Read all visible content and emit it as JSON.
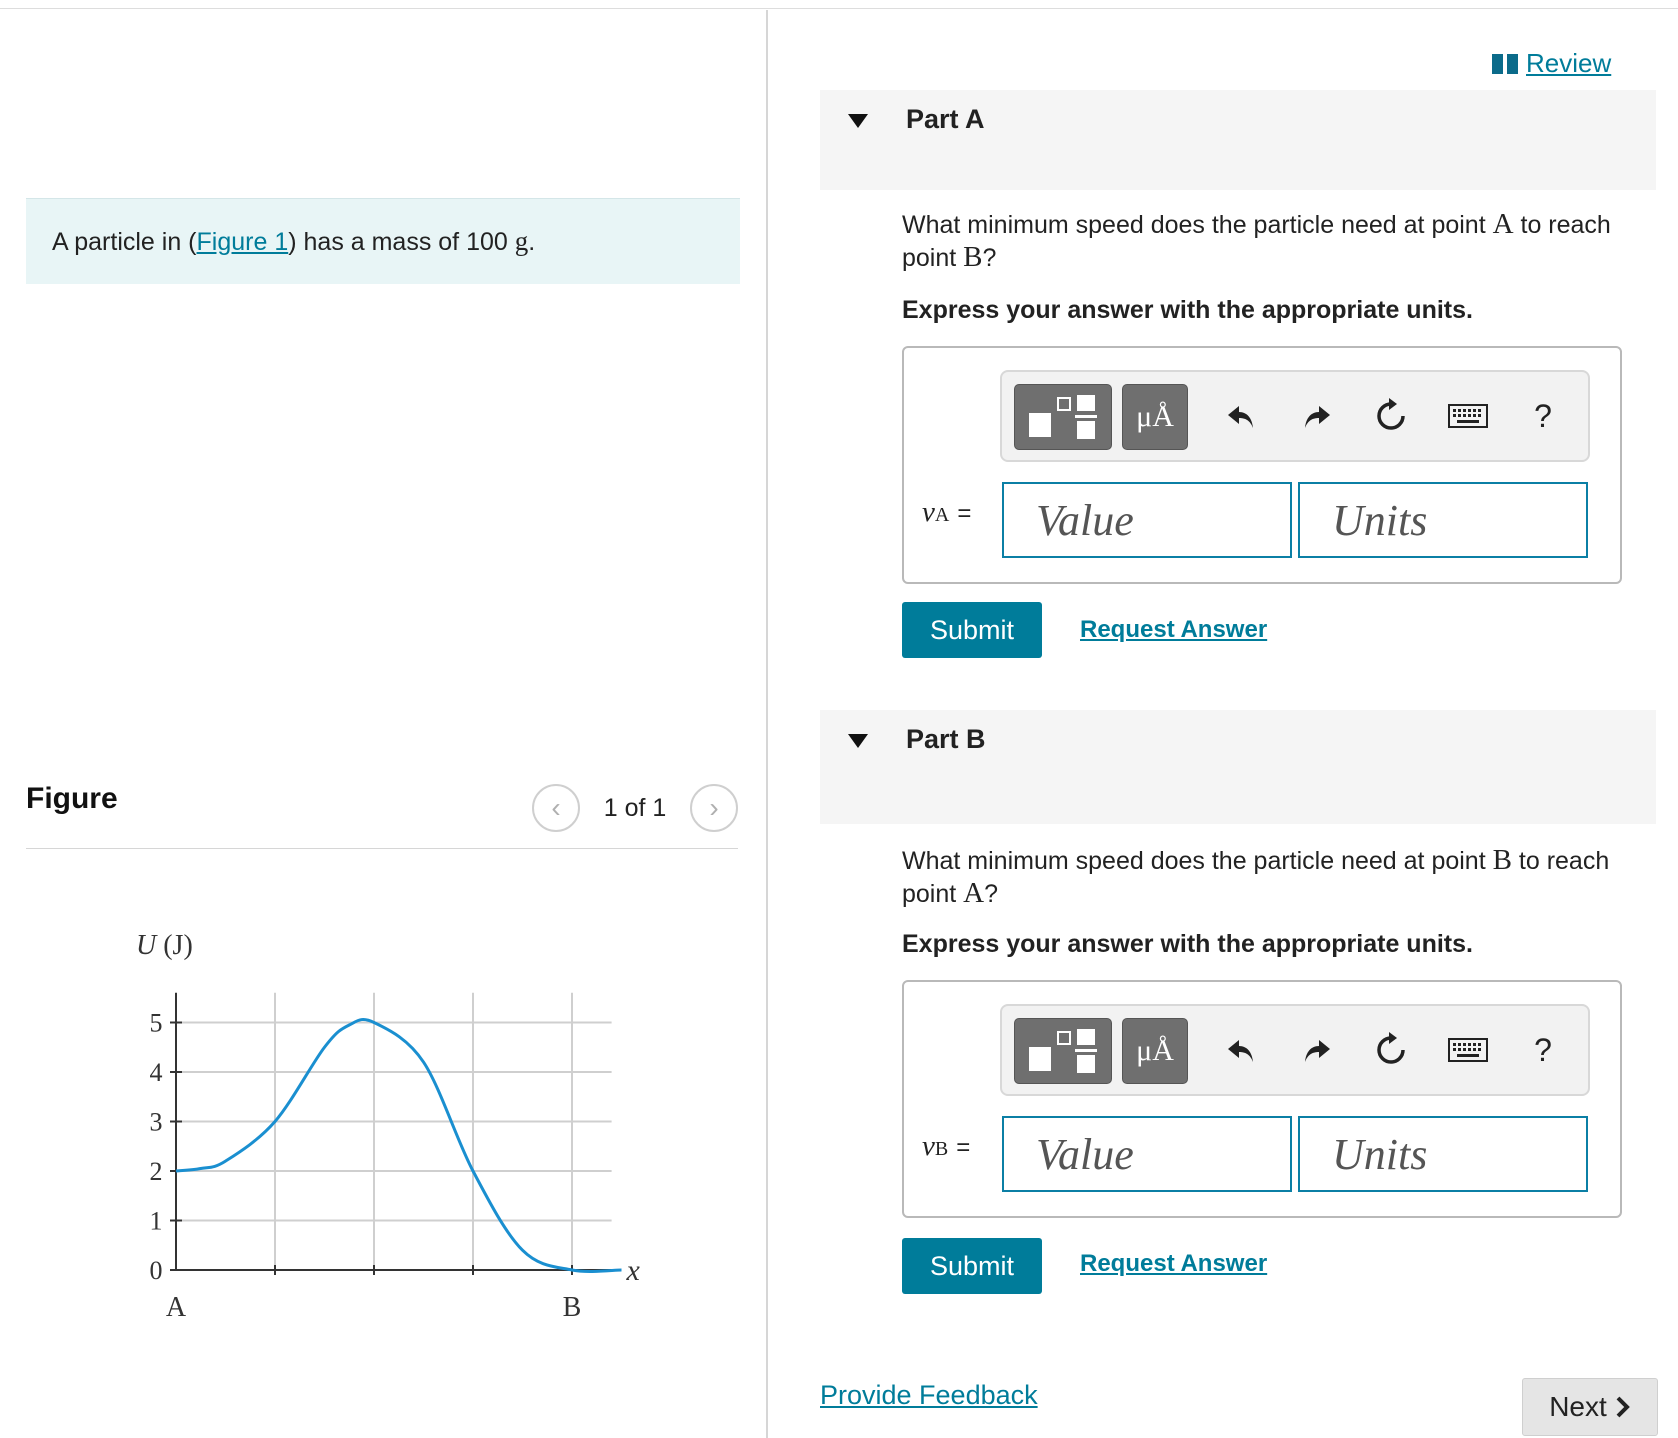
{
  "problem": {
    "intro_prefix": "A particle in (",
    "figure_link": "Figure 1",
    "intro_suffix": ") has a mass of 100 ",
    "unit": "g",
    "intro_end": "."
  },
  "figure": {
    "title": "Figure",
    "counter": "1 of 1",
    "prev_icon": "chevron-left-icon",
    "next_icon": "chevron-right-icon"
  },
  "chart_data": {
    "type": "line",
    "ylabel": "U (J)",
    "xlabel": "x",
    "x_tick_labels": [
      "A",
      "B"
    ],
    "y_ticks": [
      0,
      1,
      2,
      3,
      4,
      5
    ],
    "ylim": [
      0,
      5.5
    ],
    "grid": true,
    "series": [
      {
        "color": "#1a8fd0",
        "x": [
          0,
          0.25,
          0.5,
          1,
          1.5,
          1.75,
          2,
          2.5,
          3,
          3.5,
          4,
          4.5
        ],
        "y": [
          2,
          2.05,
          2.2,
          3,
          4.5,
          4.95,
          5,
          4.2,
          2,
          0.4,
          0,
          0
        ]
      }
    ]
  },
  "review": {
    "label": "Review",
    "icon": "book-icon"
  },
  "parts": [
    {
      "title": "Part A",
      "question_pre": "What minimum speed does the particle need at point ",
      "point_from": "A",
      "question_mid": " to reach point ",
      "point_to": "B",
      "question_end": "?",
      "instruction": "Express your answer with the appropriate units.",
      "var_symbol": "v",
      "var_sub": "A",
      "eq": "=",
      "value_placeholder": "Value",
      "units_placeholder": "Units",
      "submit": "Submit",
      "request": "Request Answer"
    },
    {
      "title": "Part B",
      "question_pre": "What minimum speed does the particle need at point ",
      "point_from": "B",
      "question_mid": " to reach point ",
      "point_to": "A",
      "question_end": "?",
      "instruction": "Express your answer with the appropriate units.",
      "var_symbol": "v",
      "var_sub": "B",
      "eq": "=",
      "value_placeholder": "Value",
      "units_placeholder": "Units",
      "submit": "Submit",
      "request": "Request Answer"
    }
  ],
  "toolbar": {
    "units_label": "μÅ",
    "help_label": "?",
    "icons": [
      "templates-icon",
      "units-icon",
      "undo-icon",
      "redo-icon",
      "reset-icon",
      "keyboard-icon",
      "help-icon"
    ]
  },
  "footer": {
    "feedback": "Provide Feedback",
    "next": "Next"
  },
  "colors": {
    "accent": "#007c9a",
    "curve": "#1a8fd0",
    "intro_bg": "#e8f5f6"
  }
}
